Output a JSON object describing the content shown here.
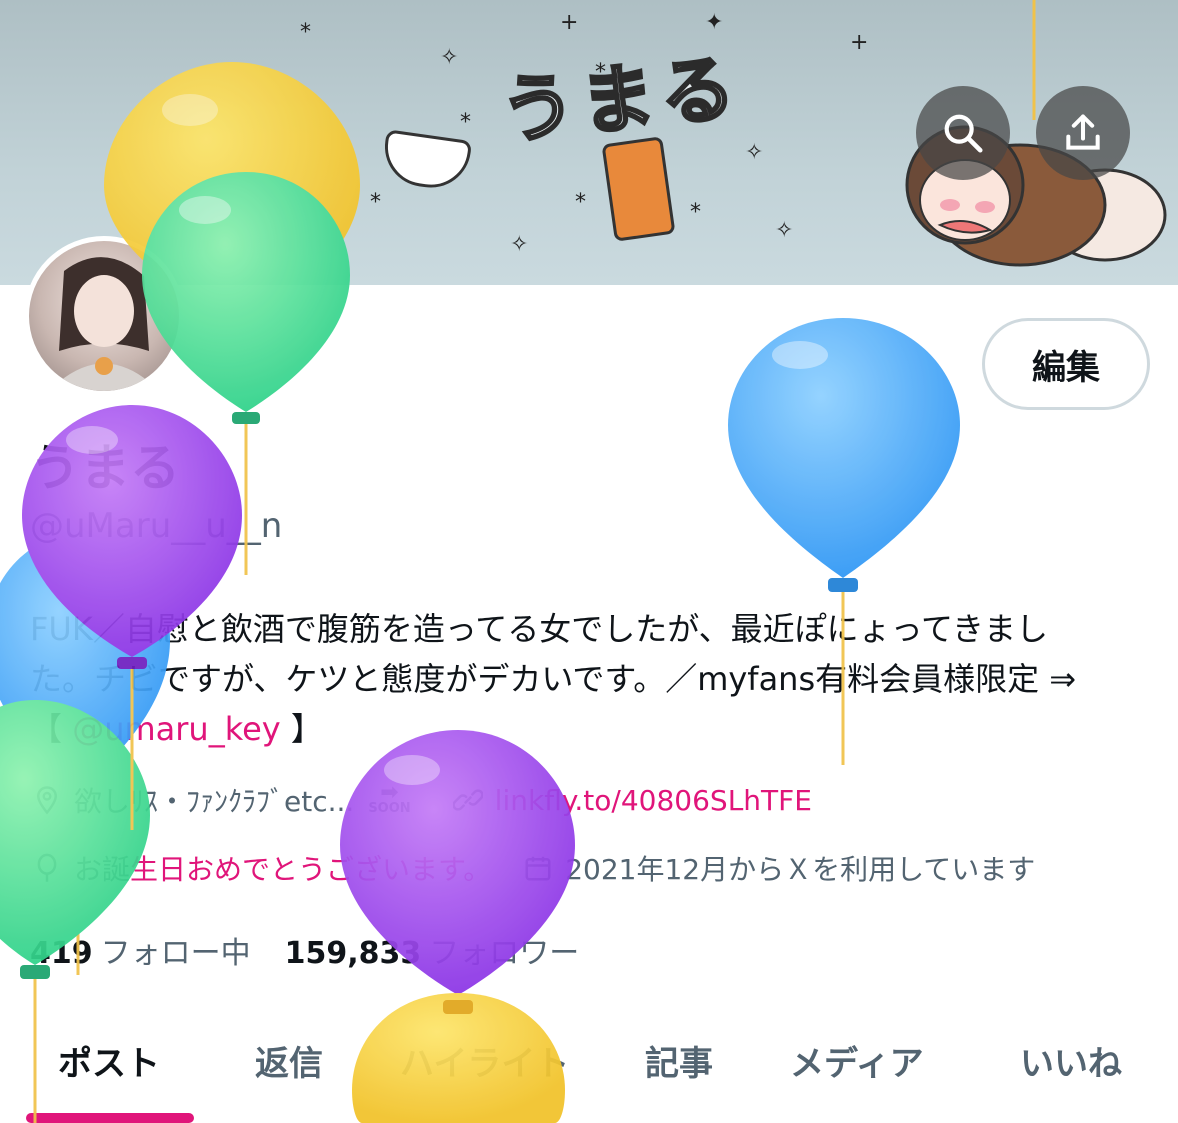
{
  "banner": {
    "title": "うまる"
  },
  "header_buttons": {
    "search_icon": "search-icon",
    "share_icon": "share-icon"
  },
  "profile": {
    "edit_label": "編集",
    "display_name": "うまる",
    "handle": "@uMaru__u__n",
    "bio_part1": "FUK／自慰と飲酒で腹筋を造ってる女でしたが、最近ぽにょってきまし",
    "bio_part2": "た。チビですが、ケツと態度がデカいです。／myfans有料会員様限定 ⇒",
    "bio_part3_open": "【 ",
    "bio_mention": "@umaru_key",
    "bio_part3_close": " 】",
    "location": "欲しﾘｽ・ﾌｧﾝｸﾗﾌﾞetc...",
    "location_badge": "SOON",
    "link": "linkfly.to/40806SLhTFE",
    "birthday_prefix": "お誕",
    "birthday_highlight": "生日おめでとうございます。",
    "joined": "2021年12月からＸを利用しています",
    "following_count": "419",
    "following_label": "フォロー中",
    "followers_count": "159,833",
    "followers_label": "フォロワー"
  },
  "tabs": [
    {
      "label": "ポスト",
      "active": true
    },
    {
      "label": "返信"
    },
    {
      "label": "ハイライト"
    },
    {
      "label": "記事"
    },
    {
      "label": "メディア"
    },
    {
      "label": "いいね"
    }
  ],
  "colors": {
    "accent": "#e0157a",
    "muted": "#536471",
    "text": "#0f1419"
  }
}
